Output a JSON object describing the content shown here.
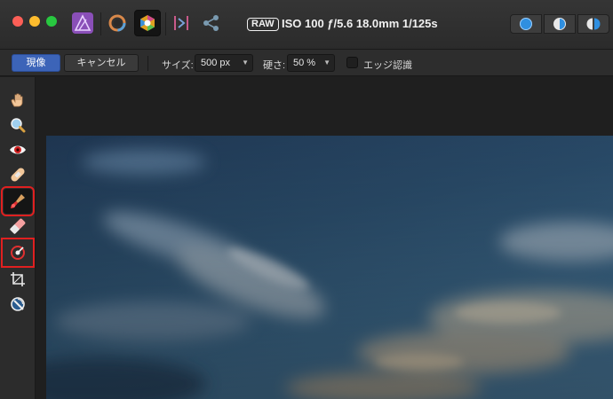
{
  "titlebar": {
    "traffic_lights": [
      "close",
      "minimize",
      "maximize"
    ],
    "personas": [
      {
        "name": "photo-persona-icon",
        "active": false
      },
      {
        "name": "develop-persona-icon",
        "active": false
      },
      {
        "name": "tone-mapping-persona-icon",
        "active": true
      },
      {
        "name": "export-persona-icon",
        "active": false
      },
      {
        "name": "share-icon",
        "active": false
      }
    ],
    "raw_badge": "RAW",
    "exif": "ISO 100 ƒ/5.6 18.0mm 1/125s",
    "view_modes": [
      "single-view-icon",
      "split-view-icon",
      "mirror-view-icon"
    ]
  },
  "context_toolbar": {
    "apply_label": "現像",
    "cancel_label": "キャンセル",
    "size_label": "サイズ:",
    "size_value": "500 px",
    "hardness_label": "硬さ:",
    "hardness_value": "50 %",
    "edge_label": "エッジ認識",
    "edge_checked": false
  },
  "tools": [
    {
      "name": "hand-tool-icon",
      "selected": false,
      "highlighted": false
    },
    {
      "name": "zoom-tool-icon",
      "selected": false,
      "highlighted": false
    },
    {
      "name": "red-eye-tool-icon",
      "selected": false,
      "highlighted": false
    },
    {
      "name": "blemish-tool-icon",
      "selected": false,
      "highlighted": false
    },
    {
      "name": "overlay-paint-tool-icon",
      "selected": true,
      "highlighted": true
    },
    {
      "name": "overlay-erase-tool-icon",
      "selected": false,
      "highlighted": false
    },
    {
      "name": "overlay-gradient-tool-icon",
      "selected": false,
      "highlighted": true
    },
    {
      "name": "crop-tool-icon",
      "selected": false,
      "highlighted": false
    },
    {
      "name": "white-balance-tool-icon",
      "selected": false,
      "highlighted": false
    }
  ],
  "colors": {
    "accent": "#3c64b8",
    "highlight": "#e02020",
    "titlebar": "#303030",
    "toolbar": "#2c2c2c",
    "canvas": "#1f1f1f"
  }
}
